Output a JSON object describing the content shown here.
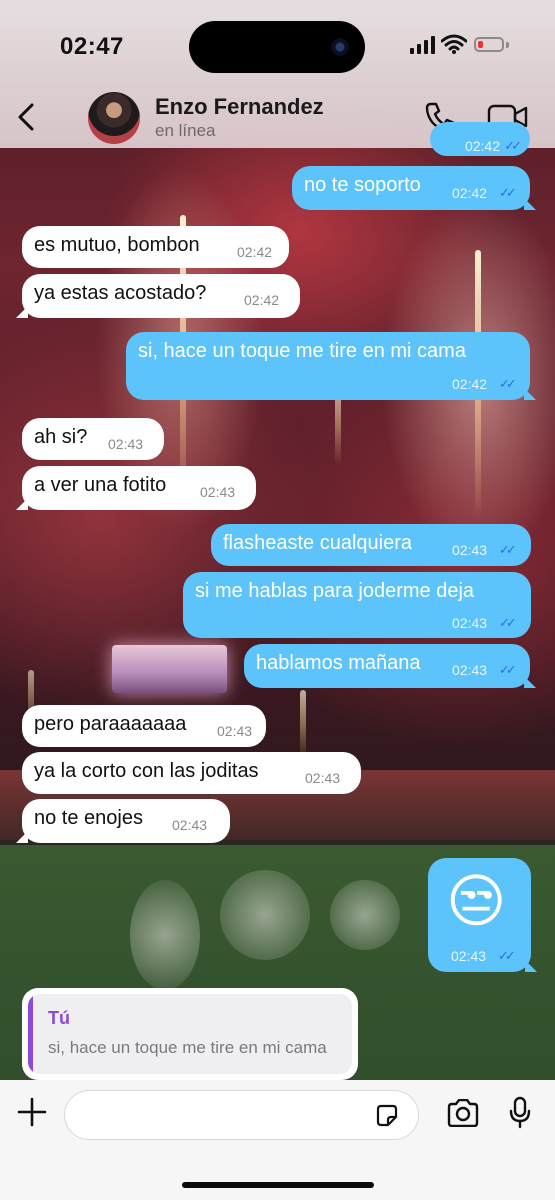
{
  "status_bar": {
    "time": "02:47"
  },
  "header": {
    "contact_name": "Enzo Fernandez",
    "contact_status": "en línea"
  },
  "messages": [
    {
      "dir": "out",
      "text": "",
      "time": "02:42",
      "read": true,
      "partial": true
    },
    {
      "dir": "out",
      "text": "no te soporto",
      "time": "02:42",
      "read": true
    },
    {
      "dir": "in",
      "text": "es mutuo, bombon",
      "time": "02:42"
    },
    {
      "dir": "in",
      "text": "ya estas acostado?",
      "time": "02:42"
    },
    {
      "dir": "out",
      "text": "si, hace un toque me tire en mi cama",
      "time": "02:42",
      "read": true
    },
    {
      "dir": "in",
      "text": "ah si?",
      "time": "02:43"
    },
    {
      "dir": "in",
      "text": "a ver una fotito",
      "time": "02:43"
    },
    {
      "dir": "out",
      "text": "flasheaste cualquiera",
      "time": "02:43",
      "read": true
    },
    {
      "dir": "out",
      "text": "si me hablas para joderme deja",
      "time": "02:43",
      "read": true
    },
    {
      "dir": "out",
      "text": "hablamos mañana",
      "time": "02:43",
      "read": true
    },
    {
      "dir": "in",
      "text": "pero paraaaaaaa",
      "time": "02:43"
    },
    {
      "dir": "in",
      "text": "ya la corto con las joditas",
      "time": "02:43"
    },
    {
      "dir": "in",
      "text": "no te enojes",
      "time": "02:43"
    },
    {
      "dir": "out",
      "text": "😒",
      "time": "02:43",
      "read": true,
      "emoji": true
    }
  ],
  "reply_preview": {
    "author": "Tú",
    "text": "si, hace un toque me tire en mi cama"
  },
  "composer": {
    "placeholder": ""
  },
  "colors": {
    "outgoing_bubble": "#5cc4fa",
    "incoming_bubble": "#ffffff",
    "read_ticks": "#2d6fe0",
    "reply_accent": "#8d4ad8"
  }
}
